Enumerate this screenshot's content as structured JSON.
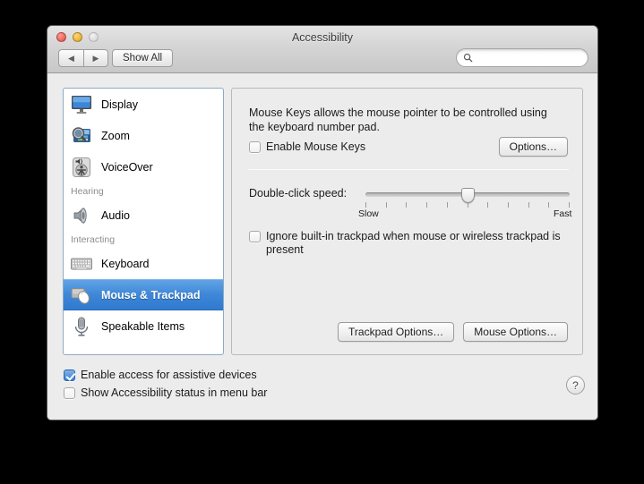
{
  "window": {
    "title": "Accessibility",
    "traffic_lights": [
      "close",
      "minimize",
      "zoom"
    ]
  },
  "toolbar": {
    "back_glyph": "◀",
    "forward_glyph": "▶",
    "show_all_label": "Show All",
    "search_placeholder": "",
    "search_value": ""
  },
  "sidebar": {
    "items": [
      {
        "type": "item",
        "label": "Display",
        "icon": "display-icon",
        "selected": false
      },
      {
        "type": "item",
        "label": "Zoom",
        "icon": "zoom-icon",
        "selected": false
      },
      {
        "type": "item",
        "label": "VoiceOver",
        "icon": "voiceover-icon",
        "selected": false
      },
      {
        "type": "group",
        "label": "Hearing"
      },
      {
        "type": "item",
        "label": "Audio",
        "icon": "audio-icon",
        "selected": false
      },
      {
        "type": "group",
        "label": "Interacting"
      },
      {
        "type": "item",
        "label": "Keyboard",
        "icon": "keyboard-icon",
        "selected": false
      },
      {
        "type": "item",
        "label": "Mouse & Trackpad",
        "icon": "mouse-trackpad-icon",
        "selected": true
      },
      {
        "type": "item",
        "label": "Speakable Items",
        "icon": "microphone-icon",
        "selected": false
      }
    ]
  },
  "content": {
    "description": "Mouse Keys allows the mouse pointer to be controlled using the keyboard number pad.",
    "enable_mouse_keys": {
      "label": "Enable Mouse Keys",
      "checked": false
    },
    "options_button": "Options…",
    "slider": {
      "label": "Double-click speed:",
      "min_label": "Slow",
      "max_label": "Fast",
      "tick_count": 11,
      "value_index": 6,
      "value_percent": 50
    },
    "ignore_trackpad": {
      "label": "Ignore built-in trackpad when mouse or wireless trackpad is present",
      "checked": false
    },
    "trackpad_options_button": "Trackpad Options…",
    "mouse_options_button": "Mouse Options…"
  },
  "footer": {
    "assistive_devices": {
      "label": "Enable access for assistive devices",
      "checked": true
    },
    "menu_bar_status": {
      "label": "Show Accessibility status in menu bar",
      "checked": false
    },
    "help_label": "?"
  },
  "colors": {
    "selection_blue": "#3e87d8",
    "checked_blue": "#3a7fd0",
    "window_bg": "#ececec",
    "desktop_bg": "#000000"
  }
}
